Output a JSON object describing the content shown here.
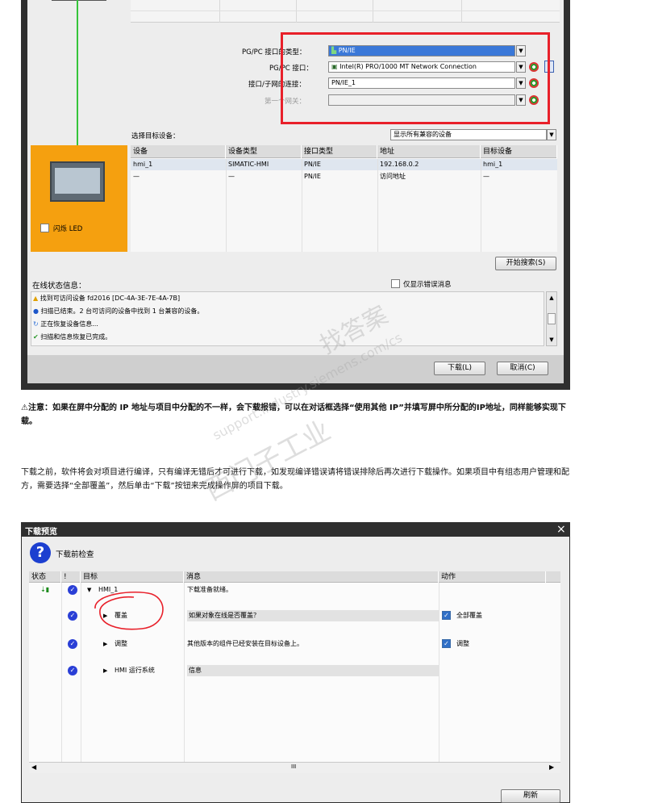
{
  "top_dialog": {
    "pgpc_type_label": "PG/PC 接口的类型：",
    "pgpc_type_value": "PN/IE",
    "pgpc_iface_label": "PG/PC 接口：",
    "pgpc_iface_value": "Intel(R) PRO/1000 MT Network Connection",
    "subnet_label": "接口/子网的连接：",
    "subnet_value": "PN/IE_1",
    "gateway_label": "第一个网关：",
    "gateway_value": "",
    "select_target_label": "选择目标设备：",
    "filter_value": "显示所有兼容的设备",
    "flash_led_label": "闪烁 LED",
    "table": {
      "columns": [
        "设备",
        "设备类型",
        "接口类型",
        "地址",
        "目标设备"
      ],
      "rows": [
        [
          "hmi_1",
          "SIMATIC-HMI",
          "PN/IE",
          "192.168.0.2",
          "hmi_1"
        ],
        [
          "—",
          "—",
          "PN/IE",
          "访问地址",
          "—"
        ]
      ]
    },
    "start_search_button": "开始搜索(S)",
    "online_status_label": "在线状态信息：",
    "only_errors_label": "仅显示错误消息",
    "messages": [
      "找到可访问设备 fd2016 [DC-4A-3E-7E-4A-7B]",
      "扫描已结束。2 台可访问的设备中找到 1 台兼容的设备。",
      "正在恢复设备信息...",
      "扫描和信息恢复已完成。"
    ],
    "load_button": "下载(L)",
    "cancel_button": "取消(C)"
  },
  "notes": {
    "warning": "注意：如果在屏中分配的 IP 地址与项目中分配的不一样，会下载报错，可以在对话框选择“使用其他 IP”并填写屏中所分配的IP地址，同样能够实现下载。",
    "paragraph": "下载之前，软件将会对项目进行编译，只有编译无错后才可进行下载，如发现编译错误请将错误排除后再次进行下载操作。如果项目中有组态用户管理和配方，需要选择“全部覆盖”，然后单击“下载”按钮来完成操作屏的项目下载。"
  },
  "preview_dialog": {
    "title": "下载预览",
    "close": "×",
    "subtitle": "下载前检查",
    "columns": [
      "状态",
      "!",
      "目标",
      "消息",
      "动作"
    ],
    "rows": [
      {
        "target": "HMI_1",
        "message": "下载准备就绪。",
        "action": "",
        "expanded": true
      },
      {
        "target": "覆盖",
        "message": "如果对象在线是否覆盖？",
        "action": "全部覆盖",
        "expanded": false
      },
      {
        "target": "调整",
        "message": "其他版本的组件已经安装在目标设备上。",
        "action": "调整",
        "expanded": false
      },
      {
        "target": "HMI 运行系统",
        "message": "信息",
        "action": "",
        "expanded": false
      }
    ],
    "scroll_mark": "III",
    "refresh_button": "刷新"
  },
  "watermark": [
    "找答案",
    "西门子工业",
    "support.industry.siemens.com/cs"
  ],
  "colors": {
    "highlight_red": "#e8202a",
    "device_orange": "#f5a00f",
    "accent_blue": "#3b5fd6",
    "dark_frame": "#2f2f2f"
  }
}
